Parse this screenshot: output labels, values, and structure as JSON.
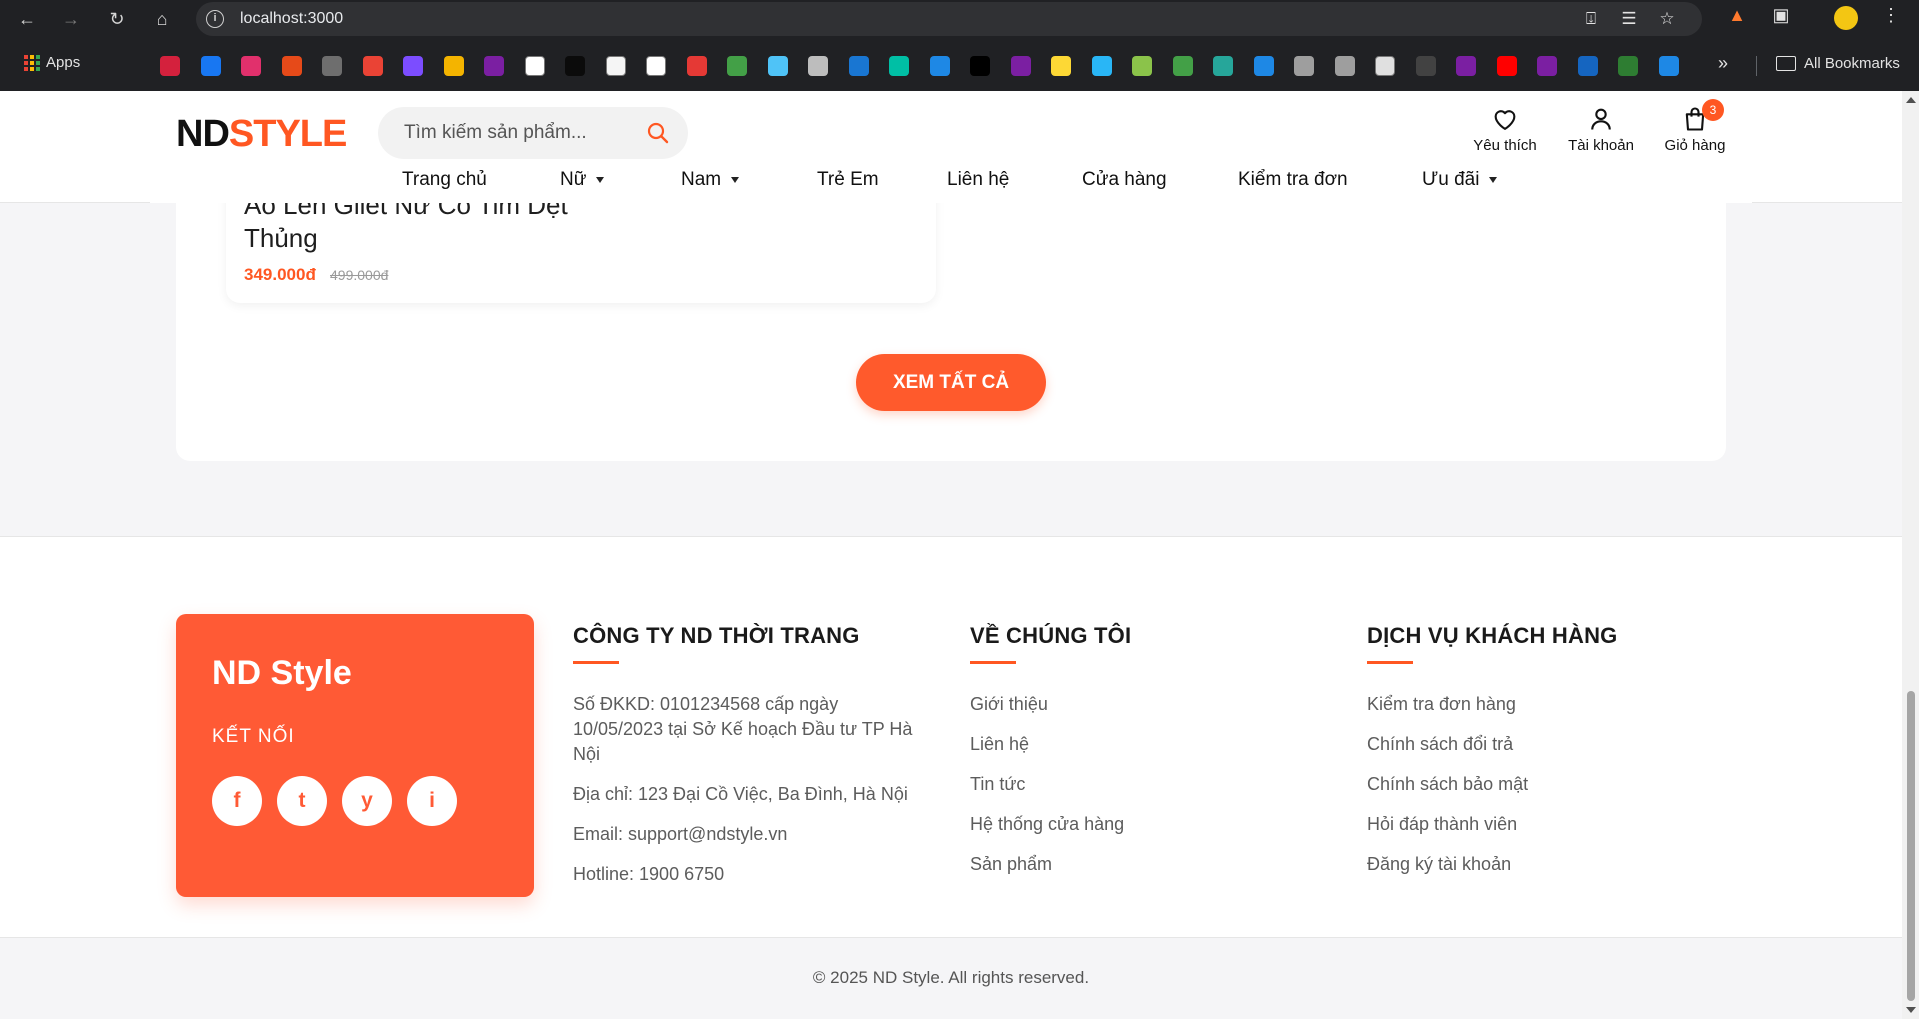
{
  "browser": {
    "url": "localhost:3000",
    "bookmarks_apps_label": "Apps",
    "all_bookmarks_label": "All Bookmarks",
    "bookmark_colors": [
      "#d4213d",
      "#1877f2",
      "#e1306c",
      "#e64a19",
      "#6e6e6e",
      "#ea4335",
      "#7c4dff",
      "#f4b400",
      "#7b1fa2",
      "#ffffff",
      "#0b0b0b",
      "#f5f5f5",
      "#ffffff",
      "#e53935",
      "#43a047",
      "#4fc3f7",
      "#bdbdbd",
      "#1976d2",
      "#00bfa5",
      "#1e88e5",
      "#000000",
      "#7b1fa2",
      "#fdd835",
      "#29b6f6",
      "#8bc34a",
      "#43a047",
      "#26a69a",
      "#1e88e5",
      "#9e9e9e",
      "#9e9e9e",
      "#e0e0e0",
      "#424242",
      "#7b1fa2",
      "#ff0000",
      "#7b1fa2",
      "#1565c0",
      "#2e7d32",
      "#1e88e5"
    ]
  },
  "header": {
    "logo_part1": "ND",
    "logo_part2": "STYLE",
    "search_placeholder": "Tìm kiếm sản phẩm...",
    "wishlist_label": "Yêu thích",
    "account_label": "Tài khoản",
    "cart_label": "Giỏ hàng",
    "cart_count": "3"
  },
  "menu": [
    {
      "label": "Trang chủ",
      "has_caret": false
    },
    {
      "label": "Nữ",
      "has_caret": true
    },
    {
      "label": "Nam",
      "has_caret": true
    },
    {
      "label": "Trẻ Em",
      "has_caret": false
    },
    {
      "label": "Liên hệ",
      "has_caret": false
    },
    {
      "label": "Cửa hàng",
      "has_caret": false
    },
    {
      "label": "Kiểm tra đơn",
      "has_caret": false
    },
    {
      "label": "Ưu đãi",
      "has_caret": true
    }
  ],
  "product": {
    "name": "Áo Len Gilet Nữ Cổ Tim Dệt Thủng",
    "price": "349.000đ",
    "old_price": "499.000đ"
  },
  "view_all_label": "XEM TẤT CẢ",
  "footer": {
    "brand_name": "ND Style",
    "connect_label": "KẾT NỐI",
    "social": [
      "f",
      "t",
      "y",
      "i"
    ],
    "company": {
      "title": "CÔNG TY ND THỜI TRANG",
      "lines": [
        "Số ĐKKD: 0101234568 cấp ngày 10/05/2023 tại Sở Kế hoạch Đầu tư TP Hà Nội",
        "Địa chỉ: 123 Đại Cồ Việc, Ba Đình, Hà Nội",
        "Email: support@ndstyle.vn",
        "Hotline: 1900 6750"
      ]
    },
    "about": {
      "title": "VỀ CHÚNG TÔI",
      "links": [
        "Giới thiệu",
        "Liên hệ",
        "Tin tức",
        "Hệ thống cửa hàng",
        "Sản phẩm"
      ]
    },
    "service": {
      "title": "DỊCH VỤ KHÁCH HÀNG",
      "links": [
        "Kiểm tra đơn hàng",
        "Chính sách đổi trả",
        "Chính sách bảo mật",
        "Hỏi đáp thành viên",
        "Đăng ký tài khoản"
      ]
    },
    "copyright": "© 2025 ND Style. All rights reserved."
  },
  "colors": {
    "accent": "#ff5722",
    "brand_box": "#ff5a35",
    "chrome_bg": "#202124"
  }
}
